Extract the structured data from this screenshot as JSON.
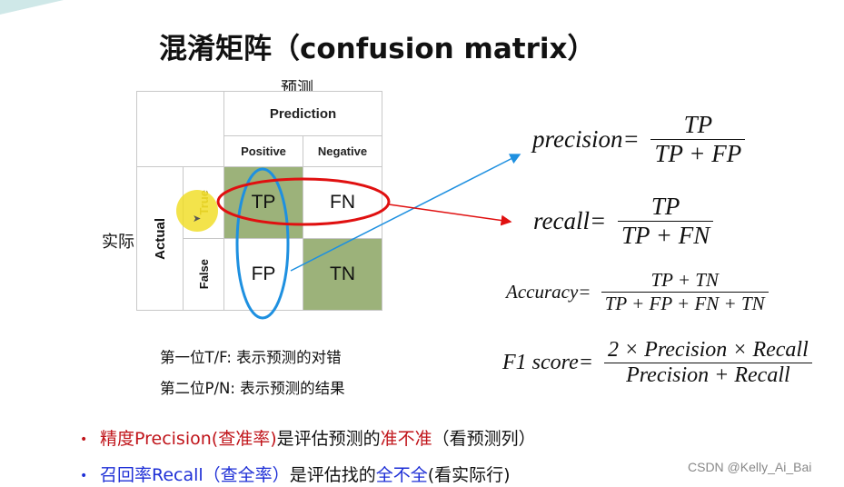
{
  "title": "混淆矩阵（confusion matrix）",
  "labels": {
    "prediction_cn": "预测",
    "actual_cn": "实际"
  },
  "matrix": {
    "prediction_header": "Prediction",
    "actual_header": "Actual",
    "columns": [
      "Positive",
      "Negative"
    ],
    "rows": [
      "True",
      "False"
    ],
    "cells": [
      {
        "label": "TP",
        "highlight": true
      },
      {
        "label": "FN",
        "highlight": false
      },
      {
        "label": "FP",
        "highlight": false
      },
      {
        "label": "TN",
        "highlight": true
      }
    ],
    "cell_color": "#9cb27a",
    "row_ellipse_color": "#e01010",
    "column_ellipse_color": "#1e90e0"
  },
  "formulas": {
    "precision": {
      "lhs": "precision",
      "num": "TP",
      "den": "TP + FP"
    },
    "recall": {
      "lhs": "recall",
      "num": "TP",
      "den": "TP + FN"
    },
    "accuracy": {
      "lhs": "Accuracy",
      "num": "TP + TN",
      "den": "TP + FP + FN + TN"
    },
    "f1": {
      "lhs": "F1 score",
      "num": "2 × Precision × Recall",
      "den": "Precision + Recall"
    }
  },
  "notes": {
    "first": "第一位T/F: 表示预测的对错",
    "second": "第二位P/N: 表示预测的结果"
  },
  "bullets": {
    "b1_bullet": "•",
    "b1_part1": "精度Precision(查准率)",
    "b1_part2": "是评估预测的",
    "b1_part3": "准不准",
    "b1_part4": "（看预测列）",
    "b2_bullet": "•",
    "b2_part1": "召回率Recall（查全率）",
    "b2_part2": "是评估找的",
    "b2_part3": "全不全",
    "b2_part4": "(看实际行)"
  },
  "colors": {
    "precision_text": "#c0141a",
    "recall_text": "#1e2fd6"
  },
  "watermark": "CSDN @Kelly_Ai_Bai"
}
